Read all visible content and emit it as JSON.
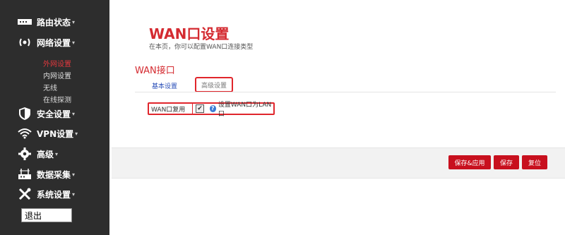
{
  "sidebar": {
    "items": [
      {
        "label": "路由状态",
        "icon": "status-bar-icon"
      },
      {
        "label": "网络设置",
        "icon": "broadcast-icon"
      },
      {
        "label": "安全设置",
        "icon": "shield-icon"
      },
      {
        "label": "VPN设置",
        "icon": "wifi-icon"
      },
      {
        "label": "高级",
        "icon": "gear-icon"
      },
      {
        "label": "数据采集",
        "icon": "router-icon"
      },
      {
        "label": "系统设置",
        "icon": "tools-icon"
      }
    ],
    "caret": "▾",
    "subitems": [
      "外网设置",
      "内网设置",
      "无线",
      "在线探测"
    ],
    "logout": "退出"
  },
  "main": {
    "title": "WAN口设置",
    "subtitle": "在本页，你可以配置WAN口连接类型",
    "section_title": "WAN接口",
    "tabs": [
      "基本设置",
      "高级设置"
    ],
    "option": {
      "label": "WAN口复用",
      "checked_glyph": "✔",
      "help_glyph": "?",
      "description": "设置WAN口为LAN口"
    },
    "buttons": {
      "apply": "保存&应用",
      "save": "保存",
      "reset": "复位"
    }
  },
  "colors": {
    "accent": "#d42b31",
    "sidebar_bg": "#2d2d2d",
    "button": "#c8101e"
  }
}
